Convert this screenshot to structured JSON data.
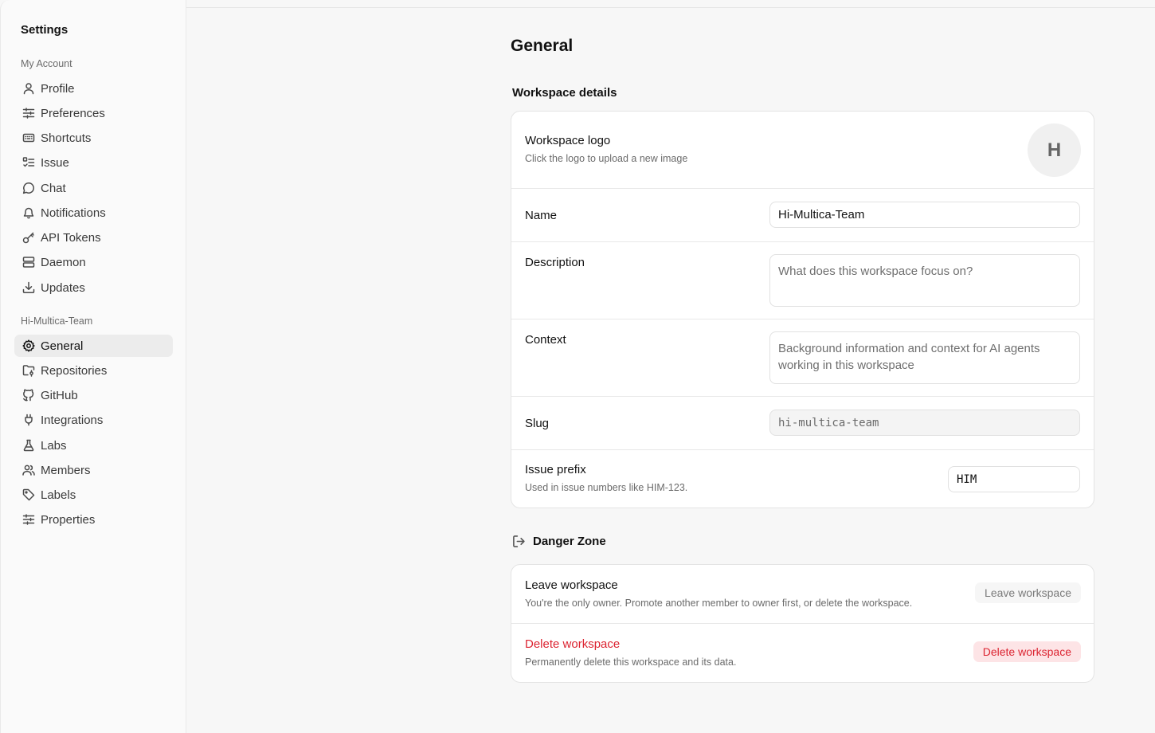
{
  "sidebar": {
    "title": "Settings",
    "account_group": "My Account",
    "account_items": [
      {
        "label": "Profile",
        "icon": "user-icon"
      },
      {
        "label": "Preferences",
        "icon": "sliders-icon"
      },
      {
        "label": "Shortcuts",
        "icon": "keyboard-icon"
      },
      {
        "label": "Issue",
        "icon": "list-checks-icon"
      },
      {
        "label": "Chat",
        "icon": "chat-bubble-icon"
      },
      {
        "label": "Notifications",
        "icon": "bell-icon"
      },
      {
        "label": "API Tokens",
        "icon": "key-icon"
      },
      {
        "label": "Daemon",
        "icon": "server-icon"
      },
      {
        "label": "Updates",
        "icon": "download-icon"
      }
    ],
    "team_group": "Hi-Multica-Team",
    "team_items": [
      {
        "label": "General",
        "icon": "gear-icon",
        "active": true
      },
      {
        "label": "Repositories",
        "icon": "folder-git-icon"
      },
      {
        "label": "GitHub",
        "icon": "github-icon"
      },
      {
        "label": "Integrations",
        "icon": "plug-icon"
      },
      {
        "label": "Labs",
        "icon": "flask-icon"
      },
      {
        "label": "Members",
        "icon": "users-icon"
      },
      {
        "label": "Labels",
        "icon": "tag-icon"
      },
      {
        "label": "Properties",
        "icon": "sliders-icon"
      }
    ]
  },
  "main": {
    "title": "General",
    "workspace_details": {
      "heading": "Workspace details",
      "logo": {
        "label": "Workspace logo",
        "hint": "Click the logo to upload a new image",
        "initial": "H"
      },
      "name": {
        "label": "Name",
        "value": "Hi-Multica-Team"
      },
      "description": {
        "label": "Description",
        "placeholder": "What does this workspace focus on?"
      },
      "context": {
        "label": "Context",
        "placeholder": "Background information and context for AI agents working in this workspace"
      },
      "slug": {
        "label": "Slug",
        "value": "hi-multica-team"
      },
      "issue_prefix": {
        "label": "Issue prefix",
        "hint": "Used in issue numbers like HIM-123.",
        "value": "HIM"
      }
    },
    "danger_zone": {
      "heading": "Danger Zone",
      "leave": {
        "label": "Leave workspace",
        "hint": "You're the only owner. Promote another member to owner first, or delete the workspace.",
        "button": "Leave workspace"
      },
      "delete": {
        "label": "Delete workspace",
        "hint": "Permanently delete this workspace and its data.",
        "button": "Delete workspace"
      }
    }
  },
  "colors": {
    "danger": "#dc2431",
    "danger_bg": "#fde4e6",
    "active_nav": "#ececec"
  }
}
